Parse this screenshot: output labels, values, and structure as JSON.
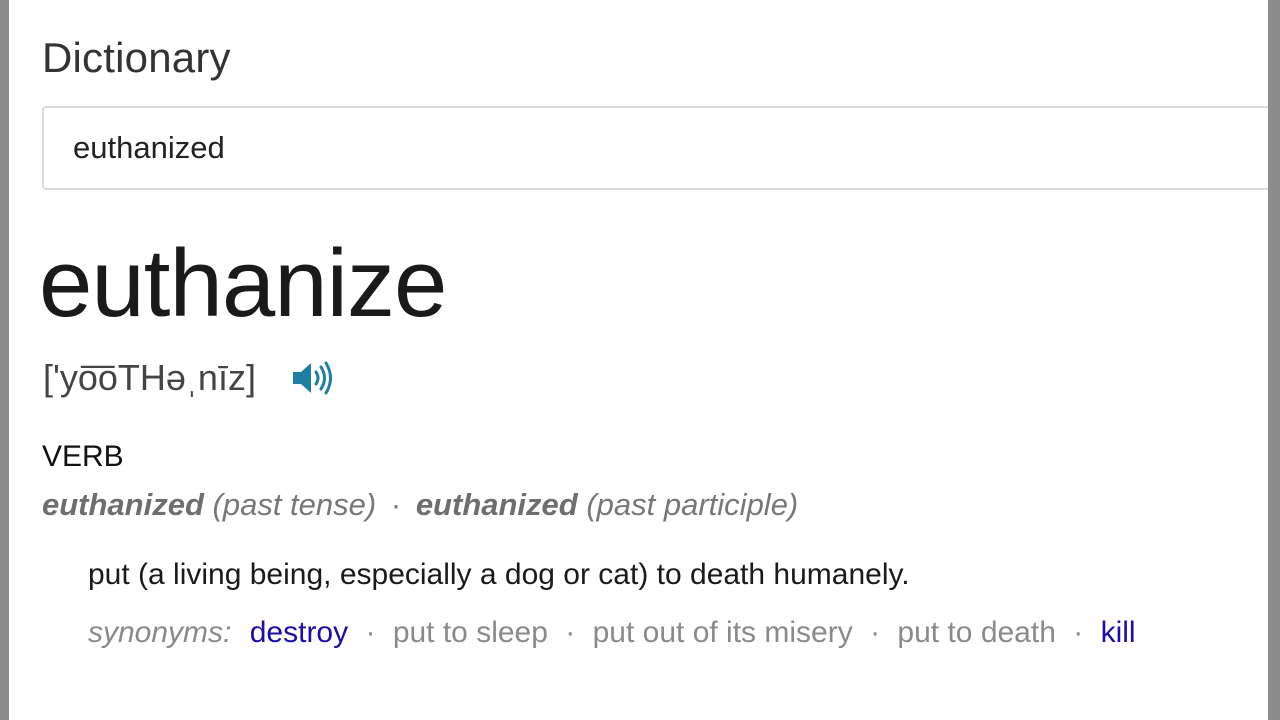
{
  "app": {
    "title": "Dictionary"
  },
  "search": {
    "value": "euthanized"
  },
  "entry": {
    "headword": "euthanize",
    "pronunciation": "['yo͞oTHəˌnīz]",
    "audio_icon": "speaker-icon",
    "part_of_speech": "VERB",
    "forms": [
      {
        "word": "euthanized",
        "tag": "(past tense)"
      },
      {
        "word": "euthanized",
        "tag": "(past participle)"
      }
    ],
    "form_separator": "·",
    "definition": "put (a living being, especially a dog or cat) to death humanely.",
    "synonyms_label": "synonyms:",
    "synonyms": [
      {
        "text": "destroy",
        "link": true
      },
      {
        "text": "put to sleep",
        "link": false
      },
      {
        "text": "put out of its misery",
        "link": false
      },
      {
        "text": "put to death",
        "link": false
      },
      {
        "text": "kill",
        "link": true
      }
    ],
    "synonym_separator": "·"
  },
  "colors": {
    "link": "#1a0dab",
    "speaker": "#1f7fa0",
    "muted": "#8a8a8a"
  }
}
